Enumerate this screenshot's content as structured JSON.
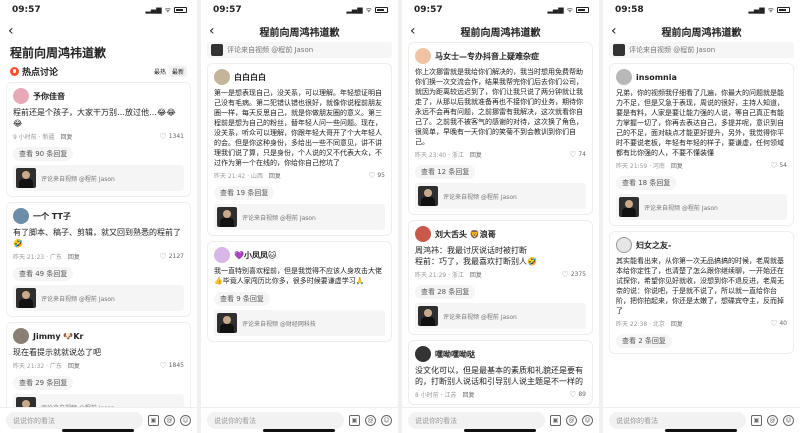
{
  "status": {
    "time1": "09:57",
    "time2": "09:57",
    "time3": "09:57",
    "time4": "09:58",
    "signal": "▂▄▆",
    "wifi": "ᯤ"
  },
  "common": {
    "title": "程前向周鸿祎道歉",
    "back": "‹",
    "input_placeholder": "说说你的看法",
    "hot": "热点讨论",
    "sort_hot": "最热",
    "sort_new": "最新",
    "quote_text": "评论来自视频 @程前 Jason"
  },
  "p1": {
    "c1": {
      "user": "予你佳音",
      "text": "程前还是个孩子，大家干万别…放过他…😂😂😂",
      "meta": "9 小时前 · 新疆",
      "reply": "回复",
      "likes": "1341",
      "more": "查看 90 条回复"
    },
    "c2": {
      "user": "一个 TT子",
      "text": "有了脚本、稿子、剪辑，就又回到熟悉的程前了🤣",
      "meta": "昨天 21:23 · 广东",
      "reply": "回复",
      "likes": "2127",
      "more": "查看 49 条回复"
    },
    "c3": {
      "user": "Jimmy 🐶Kr",
      "text": "现在看提示就就说怂了吧",
      "meta": "昨天 21:32 · 广东",
      "reply": "回复",
      "likes": "1845",
      "more": "查看 29 条回复"
    }
  },
  "p2": {
    "c1": {
      "user": "白白白白",
      "text": "第一是想表现自己，没关系，可以理解。年轻想证明自己没有毛病。第二犯错认错也很好，就像你说程前朋友圈一样，每天反思自己，就是你做朋友圈的意义。第三程前是想为自己的粉丝，替年轻人问一些问题。现在，没关系，听众可以理解，你跟年轻大哥开了个大年轻人的会。但是你这种身份，多给出一些不同意见，讲不讲理我们说了算，只是身份，个人说的又不代表大众，不过作为第一个在线的，你给你自己挖坑了",
      "meta": "昨天 21:42 · 山西",
      "reply": "回复",
      "likes": "95",
      "more": "查看 19 条回复"
    },
    "c2": {
      "user": "💜小凤凤🐱",
      "text": "我一直特别喜欢程前，但是我觉得不应该人身攻击大佬👍毕竟人家闯历比你多，很多时候要谦虚学习🙏",
      "meta": "",
      "reply": "",
      "likes": "",
      "more": "查看 9 条回复"
    },
    "q2": "评论来自视频 @财经网科技"
  },
  "p3": {
    "c1": {
      "user": "马女士—专办抖音上疑难杂症",
      "text": "你上次挪雷就是我给你们解决的，我当时想用免费帮助你们换一次交流会作，结果我帮完你们后去你们公司，就因为距离较远迟到了，你们让我只说了两分钟就让我走了，从那以后我就准备再也不接你们的业务，期待你永远不会再有问题，之前挪雷有我解决，这次就看你自己了。之前我不被客气的感谢的对待，这次换了角色，很简单，早晚有一天你们的笑菊不到会教训到你们自己。",
      "meta": "昨天 23:40 · 浙江",
      "reply": "回复",
      "likes": "74",
      "more": "查看 12 条回复"
    },
    "c2": {
      "user": "刘大舌头 🦁浪哥",
      "text": "周鸿祎：我最讨厌说话时被打断\n程前：巧了，我最喜欢打断别人🤣",
      "meta": "昨天 21:29 · 浙江",
      "reply": "回复",
      "likes": "2375",
      "more": "查看 28 条回复"
    },
    "c3": {
      "user": "嘿呦嘿呦哒",
      "text": "没文化可以，但是最基本的素质和礼貌还是要有的，打断别人说话和引导别人说主题是不一样的",
      "meta": "8 小时前 · 江苏",
      "reply": "回复",
      "likes": "89",
      "more": ""
    }
  },
  "p4": {
    "c1": {
      "user": "insomnia",
      "text": "兄弟，你的视频我仔细看了几遍，你最大的问题就是能力不足，但是又急于表现，周说的很好，主持人知道，要是有料，人家是要让能力强的人说，等自己真正有能力掌握一切了，你再去表达自己，多提并呢，意识到自己的不足，面对缺点才能更好提升，另外，我觉得你平时不要说老板，年轻有年轻的样子，要谦虚，任何领域都有比你强的人，不要不懂装懂",
      "meta": "昨天 21:59 · 河南",
      "reply": "回复",
      "likes": "54",
      "more": "查看 18 条回复"
    },
    "c2": {
      "user": "妇女之友-",
      "text": "其实能看出来，从你第一次无品搞搞的时候，老周就基本给你定性了，也清楚了怎么跟你继续聊，一开始还在试探你，希望你见好就收，没想到你不退反进，老周无奈的说：你说吧，于是就不说了，所以就一直给你台阶，把你拍起来，你还是太嫩了，想碟宾夺主，反而掉了",
      "meta": "昨天 22:38 · 北京",
      "reply": "回复",
      "likes": "40",
      "more": "查看 2 条回复"
    }
  }
}
